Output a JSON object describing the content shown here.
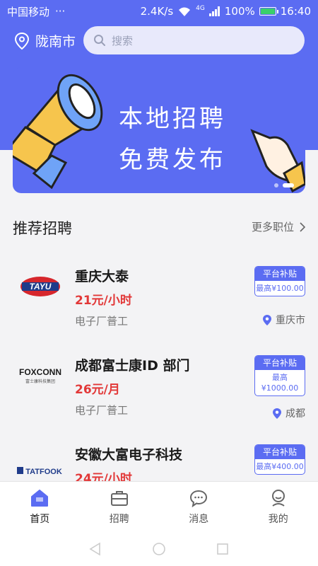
{
  "status": {
    "carrier": "中国移动",
    "more": "···",
    "speed": "2.4K/s",
    "network": "4G",
    "battery": "100%",
    "time": "16:40"
  },
  "header": {
    "city": "陇南市",
    "search_placeholder": "搜索"
  },
  "banner": {
    "line1": "本地招聘",
    "line2": "免费发布"
  },
  "section": {
    "title": "推荐招聘",
    "more": "更多职位"
  },
  "jobs": [
    {
      "logo_text": "TAYU",
      "title": "重庆大泰",
      "salary": "21元/小时",
      "category": "电子厂普工",
      "subsidy_title": "平台补贴",
      "subsidy_amount": "最高¥100.00",
      "location": "重庆市"
    },
    {
      "logo_text": "FOXCONN",
      "logo_subtext": "富士康科技集团",
      "title": "成都富士康ID 部门",
      "salary": "26元/月",
      "category": "电子厂普工",
      "subsidy_title": "平台补贴",
      "subsidy_amount_line1": "最高",
      "subsidy_amount_line2": "¥1000.00",
      "location": "成都"
    },
    {
      "logo_text": "TATFOOK",
      "title": "安徽大富电子科技",
      "salary": "24元/小时",
      "subsidy_title": "平台补贴",
      "subsidy_amount": "最高¥400.00"
    }
  ],
  "tabs": [
    {
      "label": "首页",
      "icon": "home-icon",
      "active": true
    },
    {
      "label": "招聘",
      "icon": "briefcase-icon"
    },
    {
      "label": "消息",
      "icon": "message-icon"
    },
    {
      "label": "我的",
      "icon": "profile-icon"
    }
  ],
  "colors": {
    "primary": "#5b6cf2",
    "salary": "#e23838",
    "background": "#f3f3f5"
  }
}
